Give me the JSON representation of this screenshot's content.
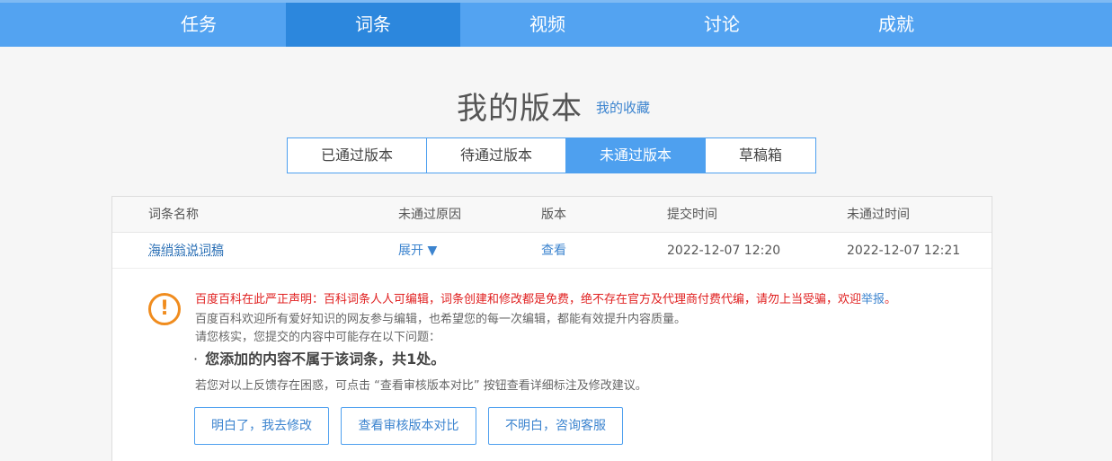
{
  "nav": {
    "tabs": [
      {
        "label": "任务"
      },
      {
        "label": "词条"
      },
      {
        "label": "视频"
      },
      {
        "label": "讨论"
      },
      {
        "label": "成就"
      }
    ],
    "active": 1
  },
  "header": {
    "title": "我的版本",
    "fav_link": "我的收藏"
  },
  "version_tabs": [
    {
      "label": "已通过版本"
    },
    {
      "label": "待通过版本"
    },
    {
      "label": "未通过版本"
    },
    {
      "label": "草稿箱"
    }
  ],
  "table": {
    "columns": [
      "词条名称",
      "未通过原因",
      "版本",
      "提交时间",
      "未通过时间"
    ],
    "rows": [
      {
        "name": "海绡翁说词稿",
        "reason": "展开 ▼",
        "version": "查看",
        "submitted": "2022-12-07 12:20",
        "rejected": "2022-12-07 12:21"
      }
    ]
  },
  "detail": {
    "warning_icon": "!",
    "statement": "百度百科在此严正声明：百科词条人人可编辑，词条创建和修改都是免费，绝不存在官方及代理商付费代编，请勿上当受骗，欢迎",
    "report_link": "举报",
    "statement_end": "。",
    "welcome": "百度百科欢迎所有爱好知识的网友参与编辑，也希望您的每一次编辑，都能有效提升内容质量。",
    "check": "请您核实，您提交的内容中可能存在以下问题：",
    "issue_dot": "·",
    "issue": "您添加的内容不属于该词条，共1处。",
    "hint": "若您对以上反馈存在困惑，可点击 “查看审核版本对比” 按钮查看详细标注及修改建议。",
    "buttons": {
      "modify": "明白了，我去修改",
      "compare": "查看审核版本对比",
      "service": "不明白，咨询客服"
    }
  },
  "colors": {
    "nav_bg": "#53a3f1",
    "nav_active": "#2c87dd",
    "accent": "#4ea0ef",
    "warning": "#f08c1e",
    "alert_red": "#e02020"
  }
}
